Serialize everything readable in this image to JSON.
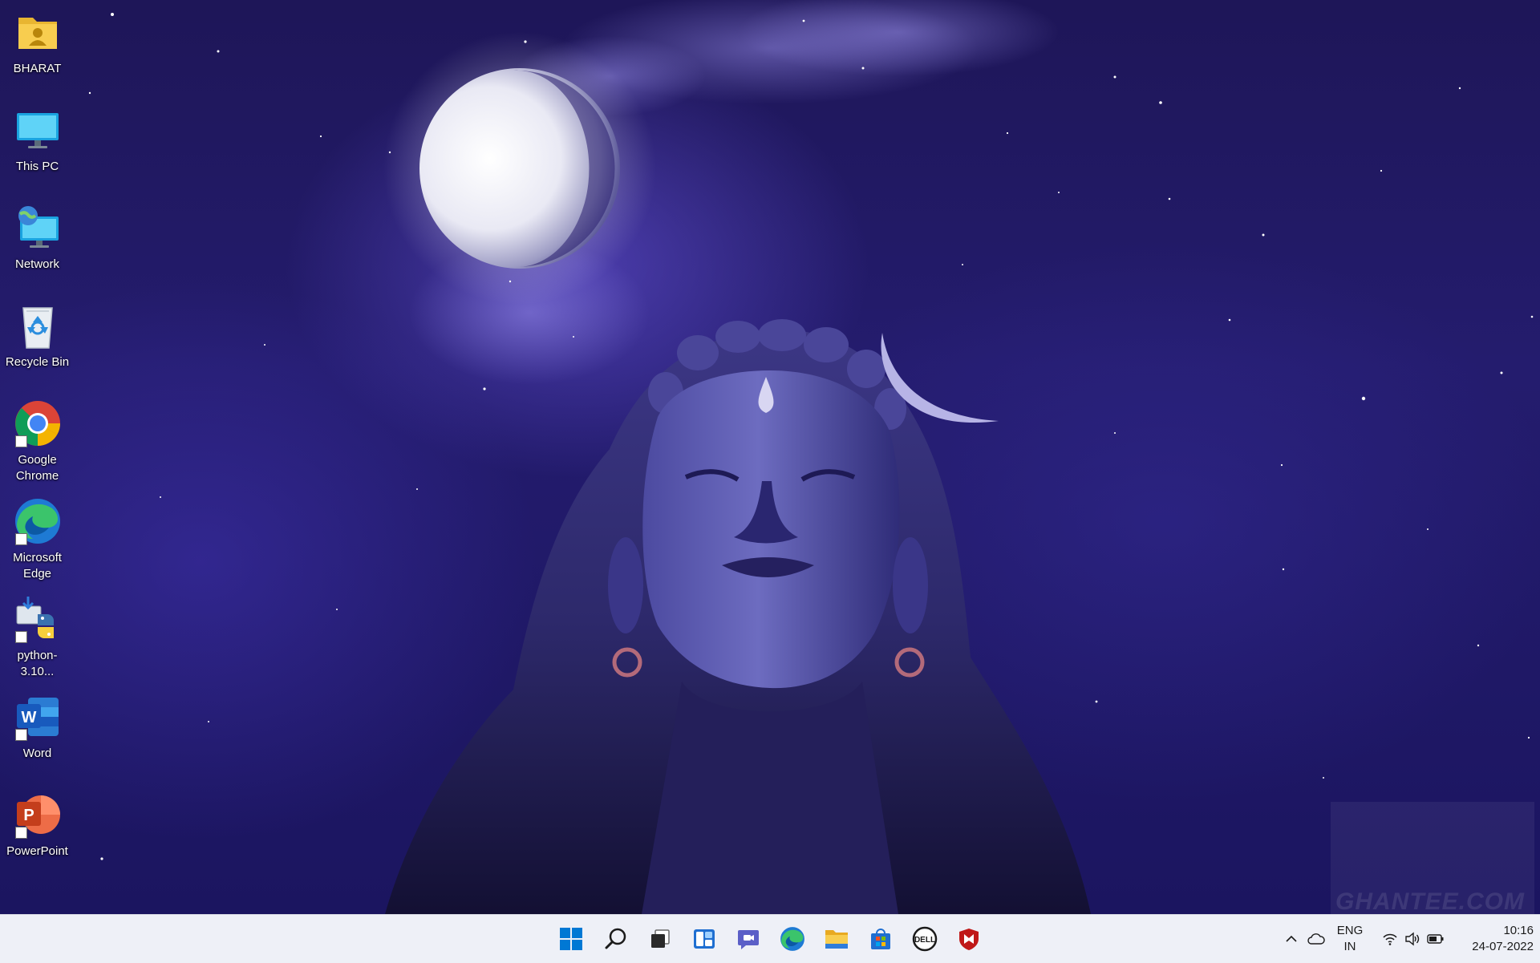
{
  "desktop": {
    "icons": [
      {
        "label": "BHARAT",
        "icon": "user-folder-icon"
      },
      {
        "label": "This PC",
        "icon": "monitor-icon"
      },
      {
        "label": "Network",
        "icon": "network-icon"
      },
      {
        "label": "Recycle Bin",
        "icon": "recycle-bin-icon"
      },
      {
        "label": "Google\nChrome",
        "icon": "chrome-icon"
      },
      {
        "label": "Microsoft\nEdge",
        "icon": "edge-icon"
      },
      {
        "label": "python-3.10...",
        "icon": "python-installer-icon"
      },
      {
        "label": "Word",
        "icon": "word-icon"
      },
      {
        "label": "PowerPoint",
        "icon": "powerpoint-icon"
      }
    ],
    "watermark": "GHANTEE.COM"
  },
  "taskbar": {
    "apps": [
      {
        "name": "Start",
        "icon": "windows-start-icon"
      },
      {
        "name": "Search",
        "icon": "search-icon"
      },
      {
        "name": "Task View",
        "icon": "task-view-icon"
      },
      {
        "name": "Widgets",
        "icon": "widgets-icon"
      },
      {
        "name": "Chat",
        "icon": "teams-chat-icon"
      },
      {
        "name": "Microsoft Edge",
        "icon": "edge-icon"
      },
      {
        "name": "File Explorer",
        "icon": "file-explorer-icon"
      },
      {
        "name": "Microsoft Store",
        "icon": "store-icon"
      },
      {
        "name": "Dell",
        "icon": "dell-icon"
      },
      {
        "name": "McAfee",
        "icon": "mcafee-icon"
      }
    ],
    "tray": {
      "language_line1": "ENG",
      "language_line2": "IN",
      "time": "10:16",
      "date": "24-07-2022"
    }
  },
  "colors": {
    "taskbar_bg": "#eef0f7",
    "wallpaper_base": "#1e1658",
    "windows_blue": "#0078d4"
  }
}
